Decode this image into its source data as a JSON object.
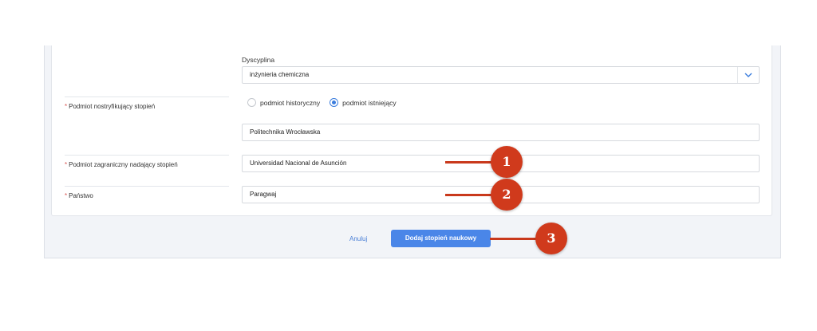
{
  "form": {
    "discipline": {
      "label": "Dyscyplina",
      "value": "inżynieria chemiczna",
      "arrow_icon": "chevron-down-icon"
    },
    "nostrifying": {
      "required_mark": "*",
      "label": "Podmiot nostryfikujący stopień",
      "options": [
        "podmiot historyczny",
        "podmiot istniejący"
      ],
      "selected_index": 1,
      "value": "Politechnika Wrocławska"
    },
    "foreign": {
      "required_mark": "*",
      "label": "Podmiot zagraniczny nadający stopień",
      "value": "Universidad Nacional de Asunción"
    },
    "country": {
      "required_mark": "*",
      "label": "Państwo",
      "value": "Paragwaj"
    }
  },
  "actions": {
    "cancel_label": "Anuluj",
    "submit_label": "Dodaj stopień naukowy"
  },
  "annotations": [
    "1",
    "2",
    "3"
  ],
  "colors": {
    "accent": "#4a86e8",
    "annotation": "#d03a1c",
    "required": "#d9534f"
  }
}
